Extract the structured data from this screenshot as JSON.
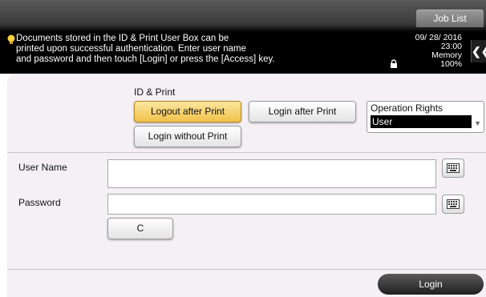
{
  "header": {
    "job_list": "Job List",
    "message": "Documents stored in the ID & Print User Box can be\nprinted upon successful authentication. Enter user name\nand password and then touch [Login] or press the [Access] key.",
    "date": "09/ 28/ 2016",
    "time": "23:00",
    "memory_label": "Memory",
    "memory_value": "100%"
  },
  "id_print": {
    "title": "ID & Print",
    "logout_after_print": "Logout after Print",
    "login_after_print": "Login after Print",
    "login_without_print": "Login without Print"
  },
  "operation_rights": {
    "label": "Operation Rights",
    "value": "User"
  },
  "form": {
    "user_name_label": "User Name",
    "user_name_value": "",
    "password_label": "Password",
    "password_value": "",
    "clear_label": "C"
  },
  "footer": {
    "login": "Login"
  },
  "icons": [
    "bulb-icon",
    "lock-icon",
    "back-icon",
    "keyboard-icon"
  ],
  "colors": {
    "selected": "#f0c24a",
    "header": "#000000",
    "panel": "#f4f0f4"
  }
}
